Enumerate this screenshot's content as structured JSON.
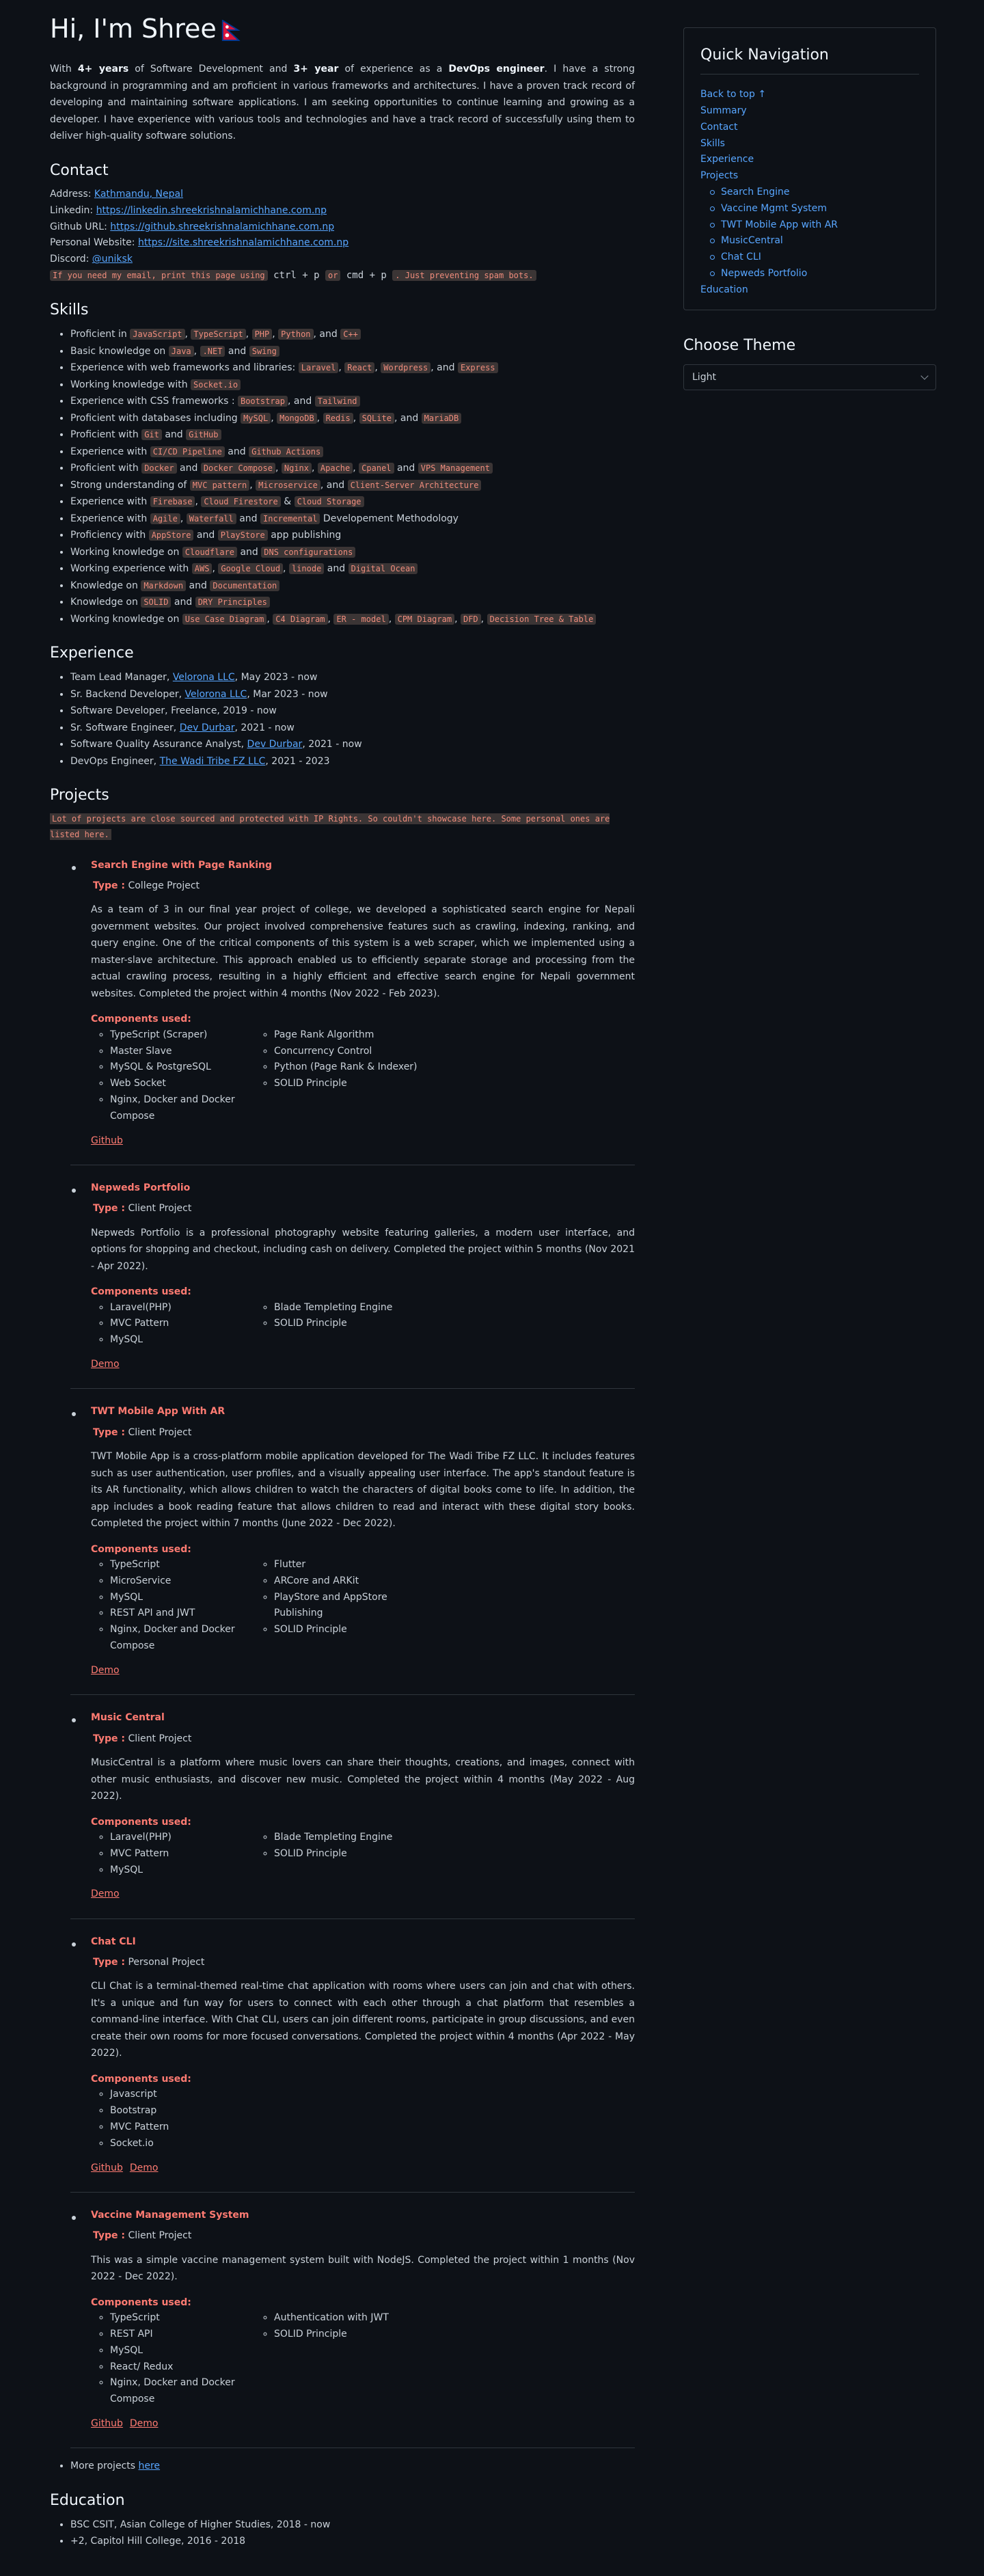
{
  "hero": {
    "title": "Hi, I'm Shree",
    "intro_1": "With ",
    "intro_years": "4+ years",
    "intro_2": " of Software Development and ",
    "intro_year2": "3+ year",
    "intro_3": " of experience as a ",
    "intro_role": "DevOps engineer",
    "intro_4": ". I have a strong background in programming and am proficient in various frameworks and architectures. I have a proven track record of developing and maintaining software applications. I am seeking opportunities to continue learning and growing as a developer. I have experience with various tools and technologies and have a track record of successfully using them to deliver high-quality software solutions."
  },
  "contact": {
    "heading": "Contact",
    "address_label": "Address: ",
    "address_value": "Kathmandu, Nepal",
    "linkedin_label": "Linkedin: ",
    "linkedin_value": "https://linkedin.shreekrishnalamichhane.com.np",
    "github_label": "Github URL: ",
    "github_value": "https://github.shreekrishnalamichhane.com.np",
    "website_label": "Personal Website: ",
    "website_value": "https://site.shreekrishnalamichhane.com.np",
    "discord_label": "Discord: ",
    "discord_value": "@uniksk",
    "spam_1": "If you need my email, print this page using",
    "spam_2": " ctrl + p ",
    "spam_3": "or",
    "spam_4": " cmd + p ",
    "spam_5": ". Just preventing spam bots."
  },
  "skills": {
    "heading": "Skills",
    "items": [
      [
        [
          "t",
          "Proficient in "
        ],
        [
          "c",
          "JavaScript"
        ],
        [
          "t",
          ", "
        ],
        [
          "c",
          "TypeScript"
        ],
        [
          "t",
          ", "
        ],
        [
          "c",
          "PHP"
        ],
        [
          "t",
          ", "
        ],
        [
          "c",
          "Python"
        ],
        [
          "t",
          ", and "
        ],
        [
          "c",
          "C++"
        ]
      ],
      [
        [
          "t",
          "Basic knowledge on "
        ],
        [
          "c",
          "Java"
        ],
        [
          "t",
          ", "
        ],
        [
          "c",
          ".NET"
        ],
        [
          "t",
          " and "
        ],
        [
          "c",
          "Swing"
        ]
      ],
      [
        [
          "t",
          "Experience with web frameworks and libraries: "
        ],
        [
          "c",
          "Laravel"
        ],
        [
          "t",
          ", "
        ],
        [
          "c",
          "React"
        ],
        [
          "t",
          ", "
        ],
        [
          "c",
          "Wordpress"
        ],
        [
          "t",
          ", and "
        ],
        [
          "c",
          "Express"
        ]
      ],
      [
        [
          "t",
          "Working knowledge with "
        ],
        [
          "c",
          "Socket.io"
        ]
      ],
      [
        [
          "t",
          "Experience with CSS frameworks : "
        ],
        [
          "c",
          "Bootstrap"
        ],
        [
          "t",
          ", and "
        ],
        [
          "c",
          "Tailwind"
        ]
      ],
      [
        [
          "t",
          "Proficient with databases including "
        ],
        [
          "c",
          "MySQL"
        ],
        [
          "t",
          ", "
        ],
        [
          "c",
          "MongoDB"
        ],
        [
          "t",
          ", "
        ],
        [
          "c",
          "Redis"
        ],
        [
          "t",
          ", "
        ],
        [
          "c",
          "SQLite"
        ],
        [
          "t",
          ", and "
        ],
        [
          "c",
          "MariaDB"
        ]
      ],
      [
        [
          "t",
          "Proficient with "
        ],
        [
          "c",
          "Git"
        ],
        [
          "t",
          " and "
        ],
        [
          "c",
          "GitHub"
        ]
      ],
      [
        [
          "t",
          "Experience with "
        ],
        [
          "c",
          "CI/CD Pipeline"
        ],
        [
          "t",
          " and "
        ],
        [
          "c",
          "Github Actions"
        ]
      ],
      [
        [
          "t",
          "Proficient with "
        ],
        [
          "c",
          "Docker"
        ],
        [
          "t",
          " and "
        ],
        [
          "c",
          "Docker Compose"
        ],
        [
          "t",
          ", "
        ],
        [
          "c",
          "Nginx"
        ],
        [
          "t",
          ", "
        ],
        [
          "c",
          "Apache"
        ],
        [
          "t",
          ", "
        ],
        [
          "c",
          "Cpanel"
        ],
        [
          "t",
          " and "
        ],
        [
          "c",
          "VPS Management"
        ]
      ],
      [
        [
          "t",
          "Strong understanding of "
        ],
        [
          "c",
          "MVC pattern"
        ],
        [
          "t",
          ", "
        ],
        [
          "c",
          "Microservice"
        ],
        [
          "t",
          ", and "
        ],
        [
          "c",
          "Client-Server Architecture"
        ]
      ],
      [
        [
          "t",
          "Experience with "
        ],
        [
          "c",
          "Firebase"
        ],
        [
          "t",
          ", "
        ],
        [
          "c",
          "Cloud Firestore"
        ],
        [
          "t",
          " & "
        ],
        [
          "c",
          "Cloud Storage"
        ]
      ],
      [
        [
          "t",
          "Experience with "
        ],
        [
          "c",
          "Agile"
        ],
        [
          "t",
          ", "
        ],
        [
          "c",
          "Waterfall"
        ],
        [
          "t",
          " and "
        ],
        [
          "c",
          "Incremental"
        ],
        [
          "t",
          " Developement Methodology"
        ]
      ],
      [
        [
          "t",
          "Proficiency with "
        ],
        [
          "c",
          "AppStore"
        ],
        [
          "t",
          " and "
        ],
        [
          "c",
          "PlayStore"
        ],
        [
          "t",
          " app publishing"
        ]
      ],
      [
        [
          "t",
          "Working knowledge on "
        ],
        [
          "c",
          "Cloudflare"
        ],
        [
          "t",
          " and "
        ],
        [
          "c",
          "DNS configurations"
        ]
      ],
      [
        [
          "t",
          "Working experience with "
        ],
        [
          "c",
          "AWS"
        ],
        [
          "t",
          ", "
        ],
        [
          "c",
          "Google Cloud"
        ],
        [
          "t",
          ", "
        ],
        [
          "c",
          "linode"
        ],
        [
          "t",
          " and "
        ],
        [
          "c",
          "Digital Ocean"
        ]
      ],
      [
        [
          "t",
          "Knowledge on "
        ],
        [
          "c",
          "Markdown"
        ],
        [
          "t",
          " and "
        ],
        [
          "c",
          "Documentation"
        ]
      ],
      [
        [
          "t",
          "Knowledge on "
        ],
        [
          "c",
          "SOLID"
        ],
        [
          "t",
          " and "
        ],
        [
          "c",
          "DRY Principles"
        ]
      ],
      [
        [
          "t",
          "Working knowledge on "
        ],
        [
          "c",
          "Use Case Diagram"
        ],
        [
          "t",
          ", "
        ],
        [
          "c",
          "C4 Diagram"
        ],
        [
          "t",
          ", "
        ],
        [
          "c",
          "ER - model"
        ],
        [
          "t",
          ", "
        ],
        [
          "c",
          "CPM Diagram"
        ],
        [
          "t",
          ", "
        ],
        [
          "c",
          "DFD"
        ],
        [
          "t",
          ", "
        ],
        [
          "c",
          "Decision Tree & Table"
        ]
      ]
    ]
  },
  "experience": {
    "heading": "Experience",
    "items": [
      {
        "pre": "Team Lead Manager, ",
        "link": "Velorona LLC",
        "post": ", May 2023 - now"
      },
      {
        "pre": "Sr. Backend Developer, ",
        "link": "Velorona LLC",
        "post": ", Mar 2023 - now"
      },
      {
        "pre": "Software Developer, Freelance, 2019 - now",
        "link": "",
        "post": ""
      },
      {
        "pre": "Sr. Software Engineer, ",
        "link": "Dev Durbar",
        "post": ", 2021 - now"
      },
      {
        "pre": "Software Quality Assurance Analyst, ",
        "link": "Dev Durbar",
        "post": ", 2021 - now"
      },
      {
        "pre": "DevOps Engineer, ",
        "link": "The Wadi Tribe FZ LLC",
        "post": ", 2021 - 2023"
      }
    ]
  },
  "projects": {
    "heading": "Projects",
    "notice": "Lot of projects are close sourced and protected with IP Rights. So couldn't showcase here. Some personal ones are listed here.",
    "type_label": "Type :",
    "components_label": "Components used:",
    "items": [
      {
        "title": "Search Engine with Page Ranking",
        "type": " College Project",
        "desc": "As a team of 3 in our final year project of college, we developed a sophisticated search engine for Nepali government websites. Our project involved comprehensive features such as crawling, indexing, ranking, and query engine. One of the critical components of this system is a web scraper, which we implemented using a master-slave architecture. This approach enabled us to efficiently separate storage and processing from the actual crawling process, resulting in a highly efficient and effective search engine for Nepali government websites. Completed the project within 4 months (Nov 2022 - Feb 2023).",
        "col1": [
          "TypeScript (Scraper)",
          "Master Slave",
          "MySQL & PostgreSQL",
          "Web Socket",
          "Nginx, Docker and Docker Compose"
        ],
        "col2": [
          "Page Rank Algorithm",
          "Concurrency Control",
          "Python (Page Rank & Indexer)",
          "SOLID Principle"
        ],
        "links": [
          "Github"
        ]
      },
      {
        "title": "Nepweds Portfolio",
        "type": " Client Project",
        "desc": "Nepweds Portfolio is a professional photography website featuring galleries, a modern user interface, and options for shopping and checkout, including cash on delivery. Completed the project within 5 months (Nov 2021 - Apr 2022).",
        "col1": [
          "Laravel(PHP)",
          "MVC Pattern",
          "MySQL"
        ],
        "col2": [
          "Blade Templeting Engine",
          "SOLID Principle"
        ],
        "links": [
          "Demo"
        ]
      },
      {
        "title": "TWT Mobile App With AR",
        "type": " Client Project",
        "desc": "TWT Mobile App is a cross-platform mobile application developed for The Wadi Tribe FZ LLC. It includes features such as user authentication, user profiles, and a visually appealing user interface. The app's standout feature is its AR functionality, which allows children to watch the characters of digital books come to life. In addition, the app includes a book reading feature that allows children to read and interact with these digital story books. Completed the project within 7 months (June 2022 - Dec 2022).",
        "col1": [
          "TypeScript",
          "MicroService",
          "MySQL",
          "REST API and JWT",
          "Nginx, Docker and Docker Compose"
        ],
        "col2": [
          "Flutter",
          "ARCore and ARKit",
          "PlayStore and AppStore Publishing",
          "SOLID Principle"
        ],
        "links": [
          "Demo"
        ]
      },
      {
        "title": "Music Central",
        "type": " Client Project",
        "desc": "MusicCentral is a platform where music lovers can share their thoughts, creations, and images, connect with other music enthusiasts, and discover new music. Completed the project within 4 months (May 2022 - Aug 2022).",
        "col1": [
          "Laravel(PHP)",
          "MVC Pattern",
          "MySQL"
        ],
        "col2": [
          "Blade Templeting Engine",
          "SOLID Principle"
        ],
        "links": [
          "Demo"
        ]
      },
      {
        "title": "Chat CLI",
        "type": " Personal Project",
        "desc": "CLI Chat is a terminal-themed real-time chat application with rooms where users can join and chat with others. It's a unique and fun way for users to connect with each other through a chat platform that resembles a command-line interface. With Chat CLI, users can join different rooms, participate in group discussions, and even create their own rooms for more focused conversations. Completed the project within 4 months (Apr 2022 - May 2022).",
        "col1": [
          "Javascript",
          "Bootstrap",
          "MVC Pattern",
          "Socket.io"
        ],
        "col2": [],
        "links": [
          "Github",
          "Demo"
        ]
      },
      {
        "title": "Vaccine Management System",
        "type": " Client Project",
        "desc": "This was a simple vaccine management system built with NodeJS. Completed the project within 1 months (Nov 2022 - Dec 2022).",
        "col1": [
          "TypeScript",
          "REST API",
          "MySQL",
          "React/ Redux",
          "Nginx, Docker and Docker Compose"
        ],
        "col2": [
          "Authentication with JWT",
          "SOLID Principle"
        ],
        "links": [
          "Github",
          "Demo"
        ]
      }
    ],
    "more_pre": "More projects ",
    "more_link": "here"
  },
  "education": {
    "heading": "Education",
    "items": [
      "BSC CSIT, Asian College of Higher Studies, 2018 - now",
      "+2, Capitol Hill College, 2016 - 2018"
    ]
  },
  "sidebar": {
    "quicknav_title": "Quick Navigation",
    "top_links": [
      "Back to top ↑",
      "Summary",
      "Contact",
      "Skills",
      "Experience",
      "Projects"
    ],
    "project_links": [
      "Search Engine",
      "Vaccine Mgmt System",
      "TWT Mobile App with AR",
      "MusicCentral",
      "Chat CLI",
      "Nepweds Portfolio"
    ],
    "bottom_links": [
      "Education"
    ],
    "theme_title": "Choose Theme",
    "theme_value": "Light"
  },
  "icons": {
    "flag": "nepal-flag-icon",
    "chevron": "chevron-down-icon"
  },
  "colors": {
    "bg": "#0d1117",
    "link": "#58a6ff",
    "accent": "#ff7b72",
    "code_bg": "#3b3535"
  }
}
